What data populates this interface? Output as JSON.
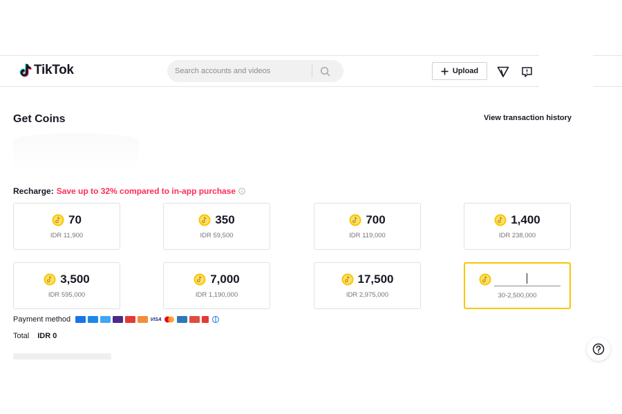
{
  "header": {
    "logo_text": "TikTok",
    "search": {
      "placeholder": "Search accounts and videos"
    },
    "upload_label": "Upload"
  },
  "page": {
    "title": "Get Coins",
    "history_link": "View transaction history"
  },
  "recharge": {
    "label": "Recharge:",
    "promo": "Save up to 32% compared to in-app purchase"
  },
  "packages": [
    {
      "coins": "70",
      "price": "IDR 11,900"
    },
    {
      "coins": "350",
      "price": "IDR 59,500"
    },
    {
      "coins": "700",
      "price": "IDR 119,000"
    },
    {
      "coins": "1,400",
      "price": "IDR 238,000"
    },
    {
      "coins": "3,500",
      "price": "IDR 595,000"
    },
    {
      "coins": "7,000",
      "price": "IDR 1,190,000"
    },
    {
      "coins": "17,500",
      "price": "IDR 2,975,000"
    }
  ],
  "custom_package": {
    "value": "",
    "range": "30-2,500,000"
  },
  "payment": {
    "label": "Payment method",
    "method_icons": [
      "bank-transfer-icon",
      "atm-icon",
      "card-icon",
      "ovo-icon",
      "linkaja-icon",
      "credit-card-icon",
      "visa-icon",
      "mastercard-icon",
      "amex-icon",
      "jcb-icon",
      "alfamart-icon",
      "diners-icon"
    ]
  },
  "total": {
    "label": "Total",
    "value": "IDR 0"
  },
  "colors": {
    "accent": "#fe2c55",
    "coin": "#f7c600",
    "selected_border": "#f7c600"
  }
}
